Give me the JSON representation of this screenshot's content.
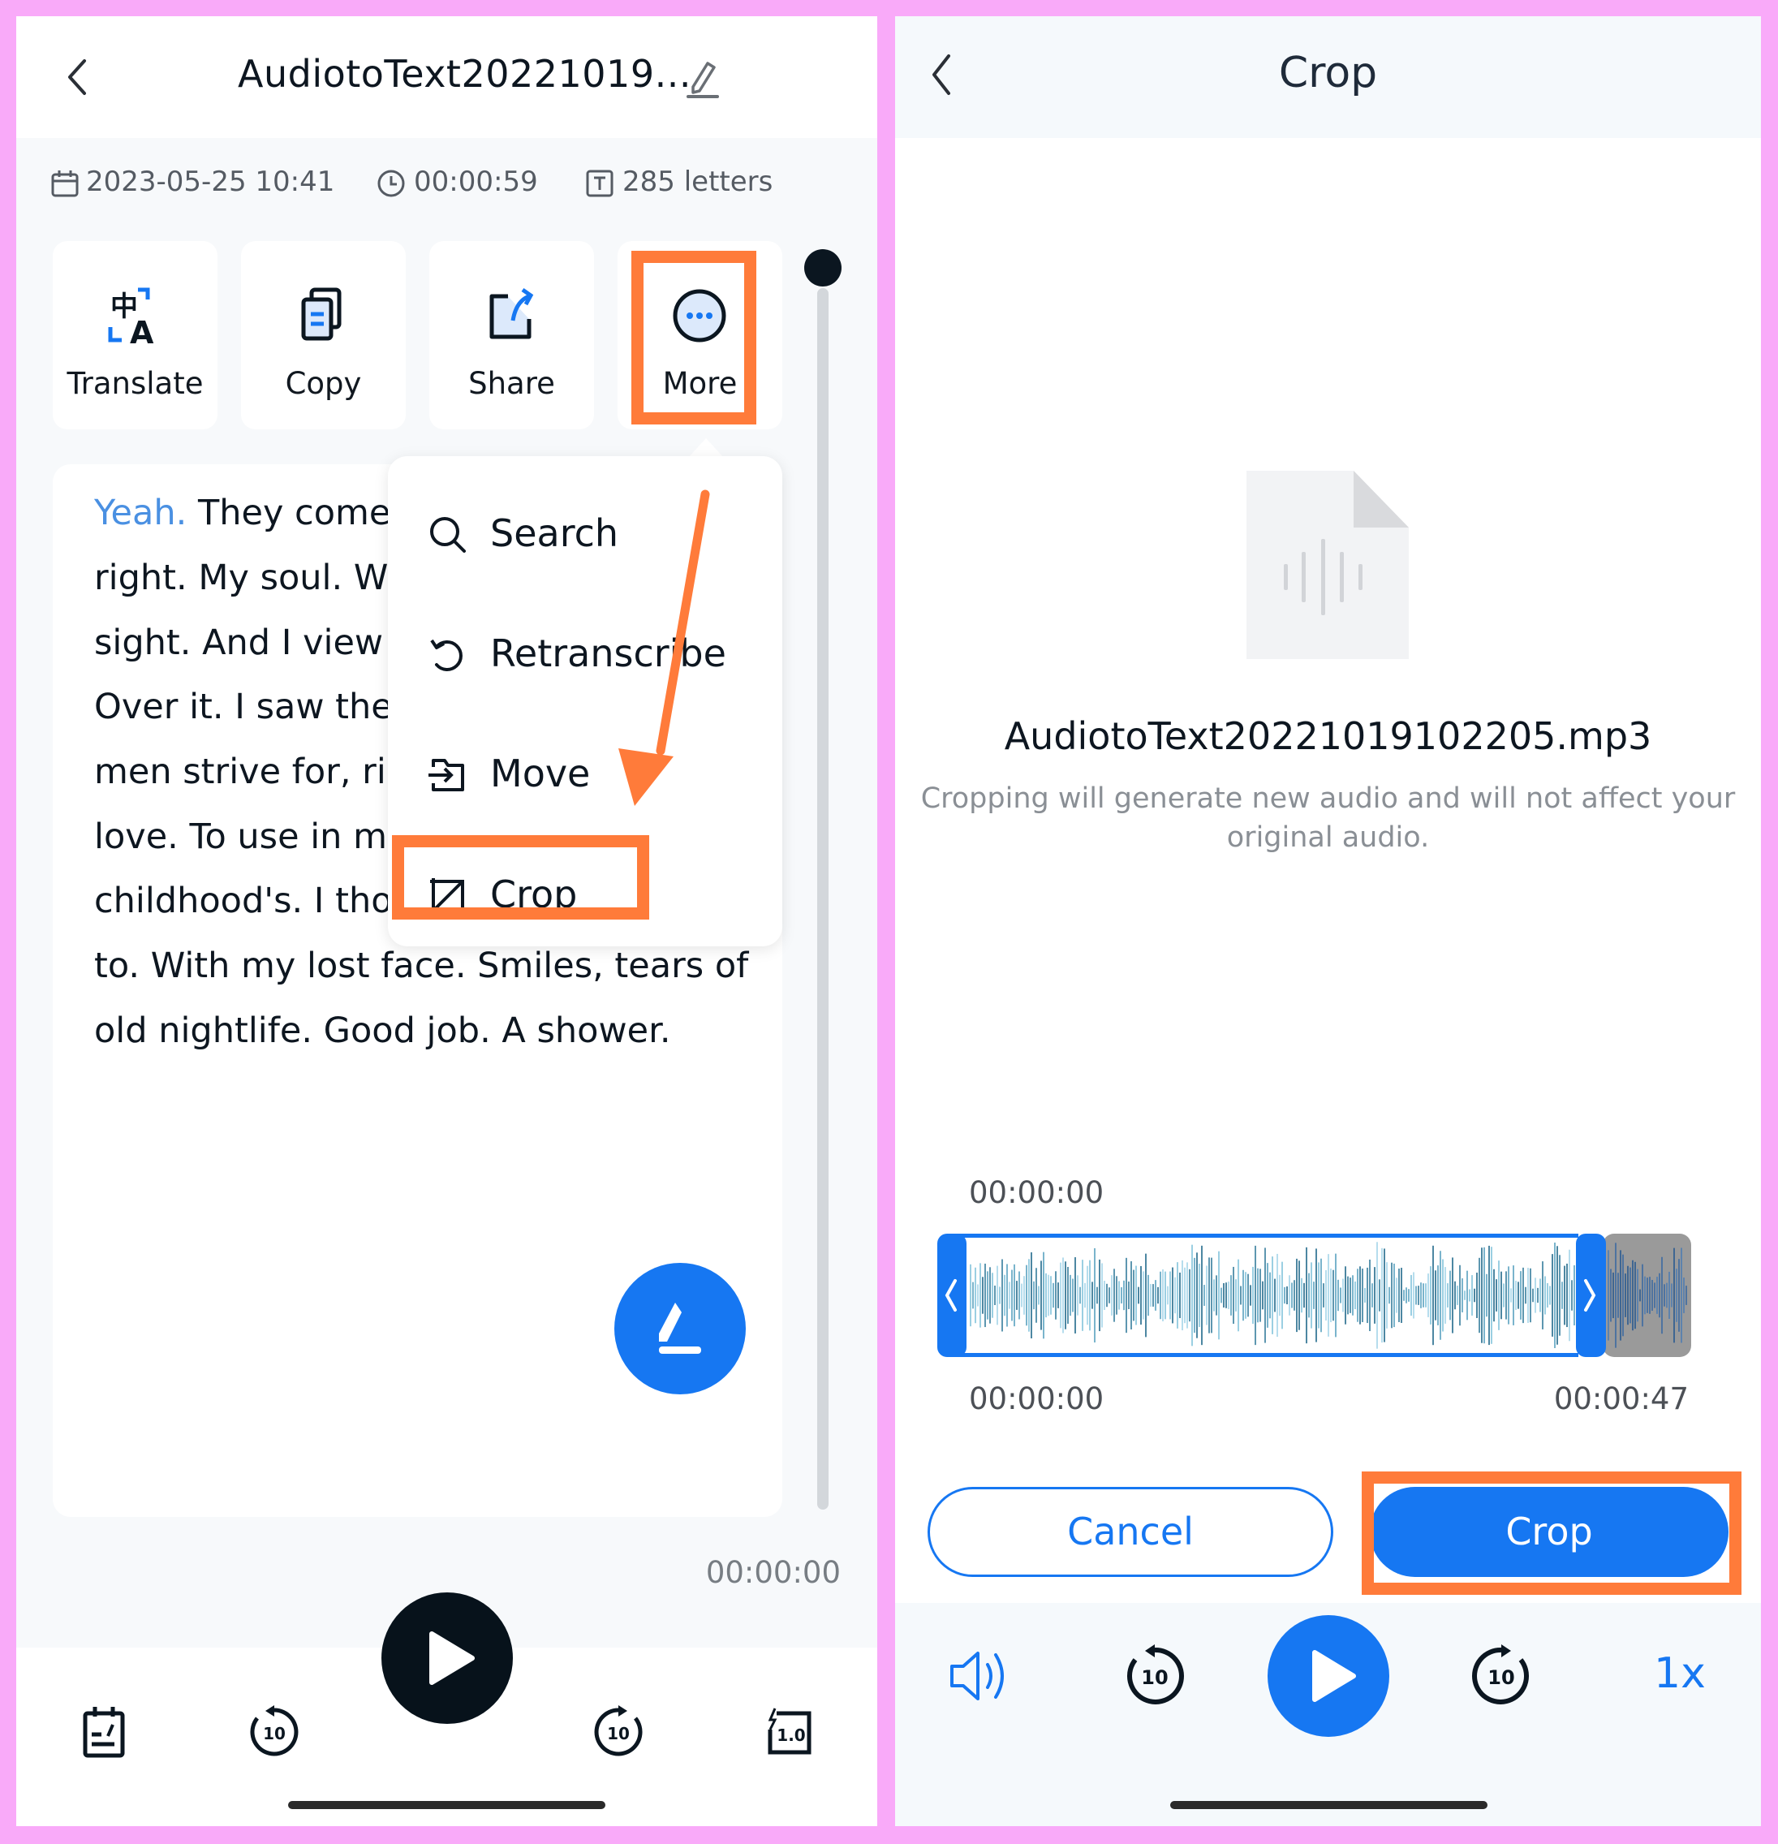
{
  "left_screen": {
    "header": {
      "back_icon": "chevron-left",
      "title": "AudiotoText20221019...",
      "edit_icon": "pencil"
    },
    "meta": {
      "date": "2023-05-25 10:41",
      "duration": "00:00:59",
      "letters": "285 letters"
    },
    "actions": [
      {
        "label": "Translate",
        "icon": "translate"
      },
      {
        "label": "Copy",
        "icon": "copy"
      },
      {
        "label": "Share",
        "icon": "share"
      },
      {
        "label": "More",
        "icon": "more-dots",
        "highlighted": true
      }
    ],
    "transcript": {
      "lines": [
        {
          "accent": "Yeah.",
          "text": " They come t"
        },
        {
          "text": "right. My soul. Wh"
        },
        {
          "text": "sight. And I view g"
        },
        {
          "text": "Over it. I saw them"
        },
        {
          "text": "men strive for, righ"
        },
        {
          "text": "love. To use in my"
        },
        {
          "text": "childhood's. I thou"
        },
        {
          "text": "to. With my lost face. Smiles, tears of"
        },
        {
          "text": "old nightlife. Good job. A shower."
        }
      ]
    },
    "more_menu": {
      "items": [
        {
          "label": "Search",
          "icon": "search"
        },
        {
          "label": "Retranscribe",
          "icon": "retranscribe"
        },
        {
          "label": "Move",
          "icon": "move"
        },
        {
          "label": "Crop",
          "icon": "crop",
          "highlighted": true
        }
      ]
    },
    "player": {
      "current_time": "00:00:00",
      "speed_icon_label": "1.0",
      "rewind_label": "10",
      "forward_label": "10"
    }
  },
  "right_screen": {
    "header": {
      "back_icon": "chevron-left",
      "title": "Crop"
    },
    "file": {
      "name": "AudiotoText20221019102205.mp3",
      "caption": "Cropping will generate new audio and will not affect your original audio."
    },
    "trim": {
      "cursor_time": "00:00:00",
      "start_time": "00:00:00",
      "end_time": "00:00:47",
      "selected_fraction_end": 0.88
    },
    "buttons": {
      "cancel": "Cancel",
      "crop": "Crop"
    },
    "player": {
      "rewind_label": "10",
      "forward_label": "10",
      "speed": "1x"
    }
  },
  "colors": {
    "accent_blue": "#1677f2",
    "highlight_orange": "#ff7b3a",
    "background_pink": "#f9aaf9"
  }
}
